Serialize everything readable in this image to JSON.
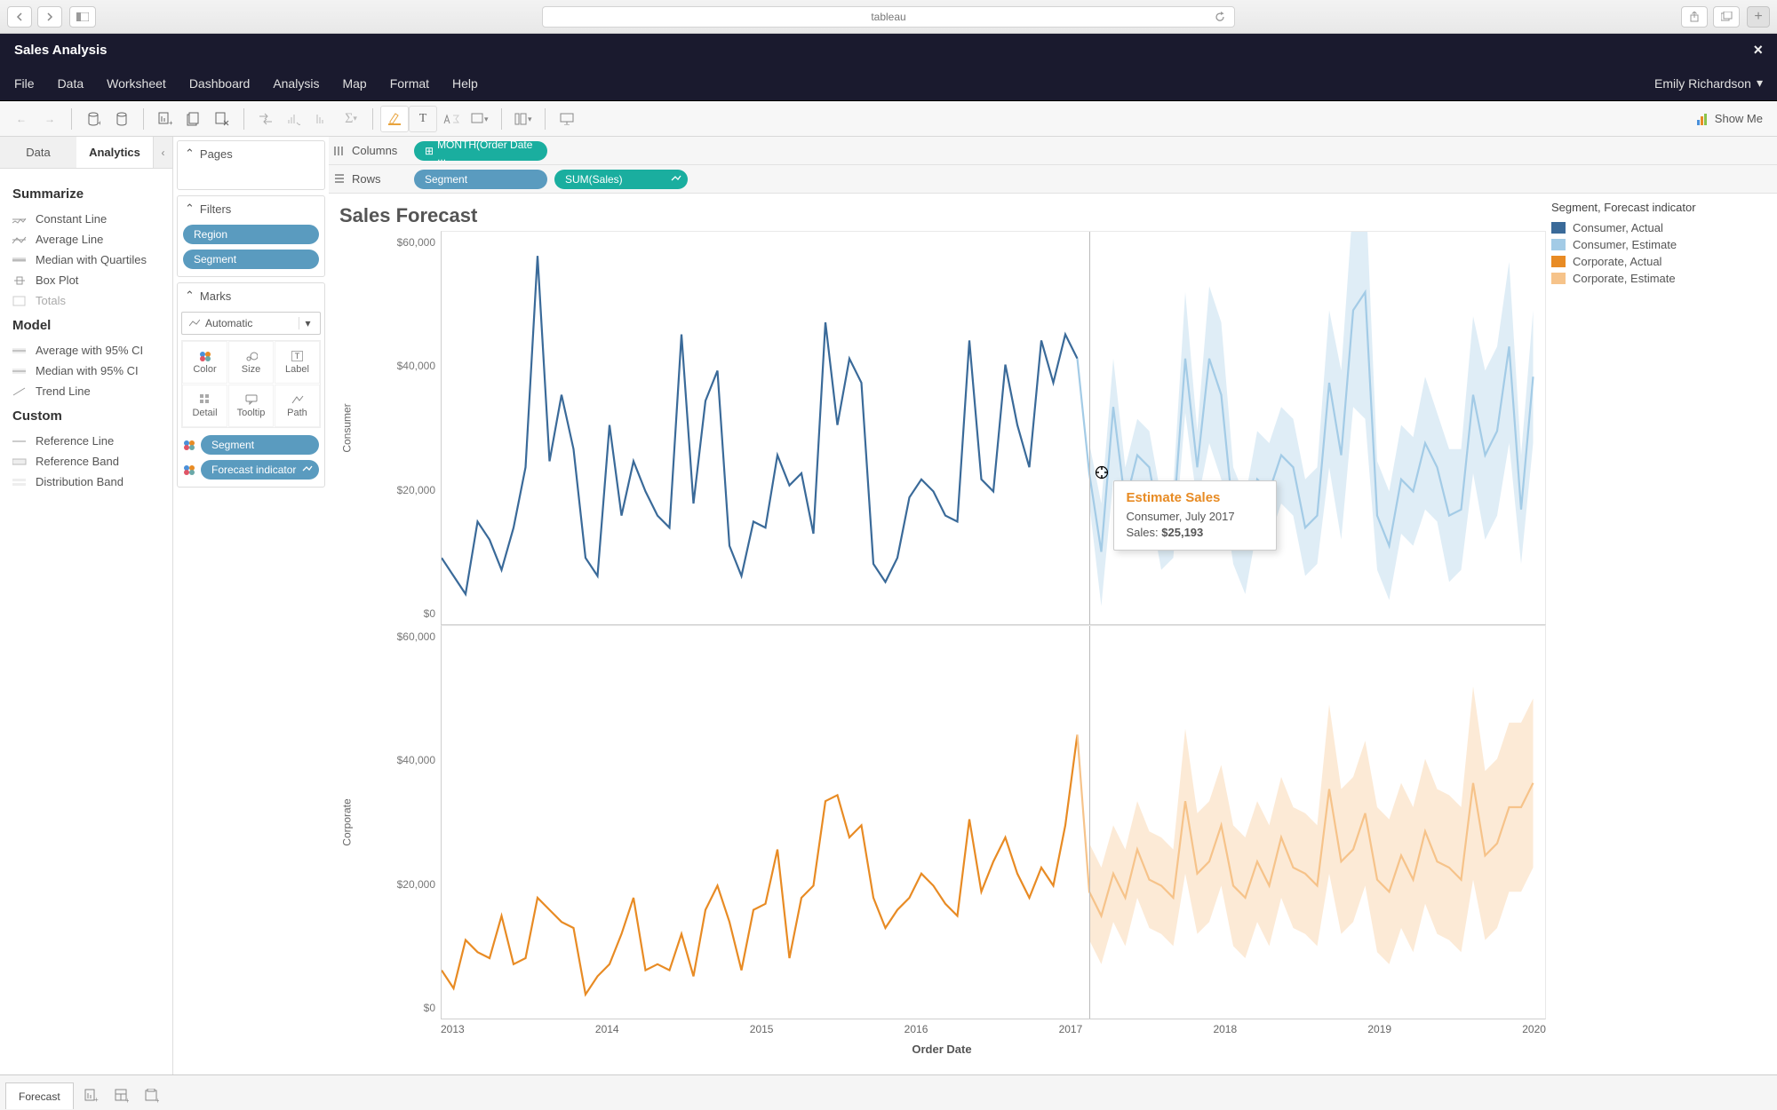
{
  "browser": {
    "address": "tableau"
  },
  "window": {
    "title": "Sales Analysis"
  },
  "menu": {
    "items": [
      "File",
      "Data",
      "Worksheet",
      "Dashboard",
      "Analysis",
      "Map",
      "Format",
      "Help"
    ],
    "user": "Emily Richardson"
  },
  "toolbar": {
    "showme": "Show Me"
  },
  "left_tabs": {
    "data": "Data",
    "analytics": "Analytics"
  },
  "analytics": {
    "summarize_title": "Summarize",
    "summarize": [
      "Constant Line",
      "Average Line",
      "Median with Quartiles",
      "Box Plot",
      "Totals"
    ],
    "model_title": "Model",
    "model": [
      "Average with 95% CI",
      "Median with 95% CI",
      "Trend Line"
    ],
    "custom_title": "Custom",
    "custom": [
      "Reference Line",
      "Reference Band",
      "Distribution Band"
    ]
  },
  "shelves": {
    "pages": "Pages",
    "filters": "Filters",
    "filter_pills": [
      "Region",
      "Segment"
    ],
    "marks": "Marks",
    "mark_type": "Automatic",
    "mark_cells": [
      "Color",
      "Size",
      "Label",
      "Detail",
      "Tooltip",
      "Path"
    ],
    "mark_pills": [
      "Segment",
      "Forecast indicator"
    ]
  },
  "rowscols": {
    "columns_label": "Columns",
    "columns_pill": "MONTH(Order Date ...",
    "rows_label": "Rows",
    "rows_pills": [
      "Segment",
      "SUM(Sales)"
    ]
  },
  "viz": {
    "title": "Sales Forecast",
    "legend_title": "Segment, Forecast indicator",
    "legend": [
      {
        "label": "Consumer, Actual",
        "color": "#3a6a99"
      },
      {
        "label": "Consumer, Estimate",
        "color": "#a3cbe6"
      },
      {
        "label": "Corporate, Actual",
        "color": "#e88b24"
      },
      {
        "label": "Corporate, Estimate",
        "color": "#f6c38a"
      }
    ],
    "yticks": [
      "$60,000",
      "$40,000",
      "$20,000",
      "$0"
    ],
    "xticks": [
      "2013",
      "2014",
      "2015",
      "2016",
      "2017",
      "2018",
      "2019",
      "2020"
    ],
    "x_title": "Order Date",
    "panel_labels": [
      "Consumer",
      "Corporate"
    ]
  },
  "tooltip": {
    "title": "Estimate Sales",
    "line1": "Consumer, July 2017",
    "sales_label": "Sales:",
    "sales_value": "$25,193"
  },
  "bottom": {
    "sheet": "Forecast"
  },
  "colors": {
    "consumer_actual": "#3a6a99",
    "consumer_est": "#a3cbe6",
    "corporate_actual": "#e88b24",
    "corporate_est": "#f6c38a"
  },
  "chart_data": [
    {
      "type": "line",
      "panel": "Consumer",
      "xlabel": "Order Date",
      "ylabel": "Sales",
      "ylim": [
        0,
        65000
      ],
      "x_years": [
        2013,
        2014,
        2015,
        2016,
        2017,
        2018,
        2019,
        2020
      ],
      "monthly_count": 92,
      "actual_months": 54,
      "series": [
        {
          "name": "Consumer, Actual",
          "color": "#3a6a99",
          "values": [
            11000,
            8000,
            5000,
            17000,
            14000,
            9000,
            16000,
            26000,
            61000,
            27000,
            38000,
            29000,
            11000,
            8000,
            33000,
            18000,
            27000,
            22000,
            18000,
            16000,
            48000,
            20000,
            37000,
            42000,
            13000,
            8000,
            17000,
            16000,
            28000,
            23000,
            25000,
            15000,
            50000,
            33000,
            44000,
            40000,
            10000,
            7000,
            11000,
            21000,
            24000,
            22000,
            18000,
            17000,
            47000,
            24000,
            22000,
            43000,
            33000,
            26000,
            47000,
            40000,
            48000,
            44000
          ]
        },
        {
          "name": "Consumer, Estimate",
          "color": "#a3cbe6",
          "values": [
            25000,
            12000,
            36000,
            20000,
            28000,
            26000,
            15000,
            17000,
            44000,
            26000,
            44000,
            38000,
            18000,
            13000,
            24000,
            22000,
            28000,
            26000,
            16000,
            18000,
            40000,
            28000,
            52000,
            55000,
            18000,
            13000,
            24000,
            22000,
            30000,
            26000,
            18000,
            19000,
            38000,
            28000,
            32000,
            46000,
            19000,
            41000
          ],
          "band_low": [
            20000,
            3000,
            24000,
            14000,
            22000,
            20000,
            9000,
            11000,
            35000,
            20000,
            30000,
            24000,
            10000,
            5000,
            16000,
            14000,
            20000,
            18000,
            8000,
            10000,
            26000,
            14000,
            36000,
            34000,
            9000,
            4000,
            15000,
            13000,
            19000,
            17000,
            7000,
            9000,
            25000,
            14000,
            18000,
            30000,
            10000,
            30000
          ],
          "band_high": [
            30000,
            20000,
            44000,
            26000,
            34000,
            32000,
            21000,
            23000,
            55000,
            32000,
            56000,
            50000,
            26000,
            21000,
            32000,
            30000,
            36000,
            34000,
            24000,
            26000,
            52000,
            42000,
            70000,
            74000,
            27000,
            22000,
            33000,
            31000,
            41000,
            35000,
            29000,
            29000,
            51000,
            42000,
            46000,
            60000,
            28000,
            52000
          ]
        }
      ]
    },
    {
      "type": "line",
      "panel": "Corporate",
      "xlabel": "Order Date",
      "ylabel": "Sales",
      "ylim": [
        0,
        65000
      ],
      "series": [
        {
          "name": "Corporate, Actual",
          "color": "#e88b24",
          "values": [
            8000,
            5000,
            13000,
            11000,
            10000,
            17000,
            9000,
            10000,
            20000,
            18000,
            16000,
            15000,
            4000,
            7000,
            9000,
            14000,
            20000,
            8000,
            9000,
            8000,
            14000,
            7000,
            18000,
            22000,
            16000,
            8000,
            18000,
            19000,
            28000,
            10000,
            20000,
            22000,
            36000,
            37000,
            30000,
            32000,
            20000,
            15000,
            18000,
            20000,
            24000,
            22000,
            19000,
            17000,
            33000,
            21000,
            26000,
            30000,
            24000,
            20000,
            25000,
            22000,
            32000,
            47000
          ]
        },
        {
          "name": "Corporate, Estimate",
          "color": "#f6c38a",
          "values": [
            21000,
            17000,
            24000,
            20000,
            28000,
            23000,
            22000,
            20000,
            36000,
            24000,
            26000,
            32000,
            22000,
            20000,
            26000,
            22000,
            30000,
            25000,
            24000,
            22000,
            38000,
            26000,
            28000,
            34000,
            23000,
            21000,
            27000,
            23000,
            31000,
            26000,
            25000,
            23000,
            39000,
            27000,
            29000,
            35000,
            35000,
            39000
          ],
          "band_low": [
            13000,
            9000,
            16000,
            12000,
            20000,
            15000,
            14000,
            12000,
            24000,
            14000,
            16000,
            22000,
            12000,
            10000,
            16000,
            12000,
            20000,
            15000,
            14000,
            12000,
            24000,
            14000,
            16000,
            22000,
            11000,
            9000,
            15000,
            11000,
            19000,
            14000,
            13000,
            11000,
            23000,
            13000,
            15000,
            21000,
            21000,
            25000
          ],
          "band_high": [
            29000,
            25000,
            32000,
            28000,
            36000,
            31000,
            30000,
            28000,
            48000,
            34000,
            36000,
            42000,
            32000,
            30000,
            36000,
            32000,
            40000,
            35000,
            34000,
            32000,
            52000,
            38000,
            40000,
            46000,
            35000,
            33000,
            39000,
            35000,
            43000,
            38000,
            37000,
            35000,
            55000,
            41000,
            43000,
            49000,
            49000,
            53000
          ]
        }
      ]
    }
  ]
}
